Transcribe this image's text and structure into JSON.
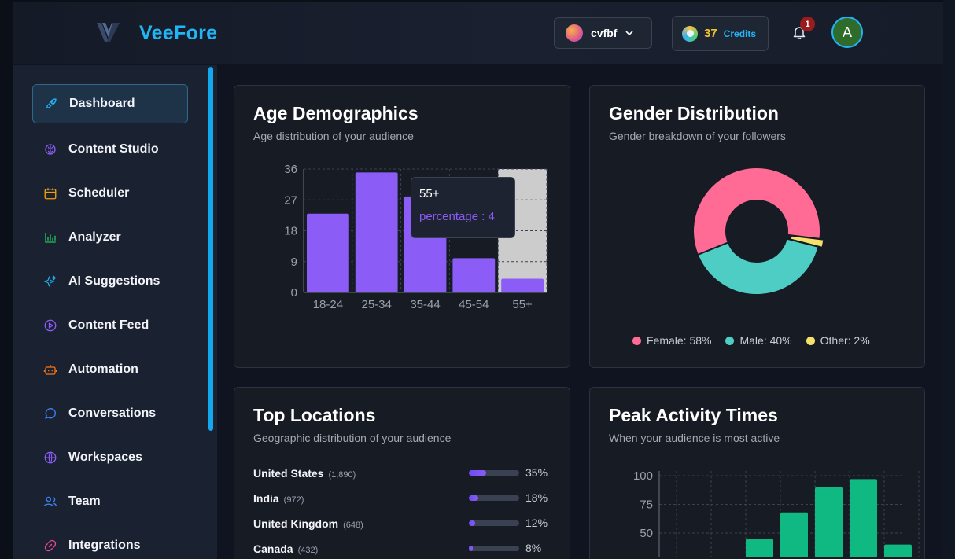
{
  "header": {
    "brand": "VeeFore",
    "workspace": {
      "name": "cvfbf"
    },
    "credits": {
      "count": "37",
      "label": "Credits"
    },
    "notifications": {
      "count": "1"
    },
    "user": {
      "initial": "A"
    }
  },
  "sidebar": {
    "items": [
      {
        "label": "Dashboard",
        "icon": "rocket-icon",
        "color": "#22b5f5"
      },
      {
        "label": "Content Studio",
        "icon": "brain-icon",
        "color": "#8b5cf6"
      },
      {
        "label": "Scheduler",
        "icon": "calendar-icon",
        "color": "#f59e0b"
      },
      {
        "label": "Analyzer",
        "icon": "bar-chart-icon",
        "color": "#22c55e"
      },
      {
        "label": "AI Suggestions",
        "icon": "sparkles-icon",
        "color": "#22b5f5"
      },
      {
        "label": "Content Feed",
        "icon": "play-circle-icon",
        "color": "#8b5cf6"
      },
      {
        "label": "Automation",
        "icon": "bot-icon",
        "color": "#f97316"
      },
      {
        "label": "Conversations",
        "icon": "message-icon",
        "color": "#3b82f6"
      },
      {
        "label": "Workspaces",
        "icon": "globe-icon",
        "color": "#8b5cf6"
      },
      {
        "label": "Team",
        "icon": "users-icon",
        "color": "#3b82f6"
      },
      {
        "label": "Integrations",
        "icon": "link-icon",
        "color": "#ec4899"
      }
    ]
  },
  "age_card": {
    "title": "Age Demographics",
    "subtitle": "Age distribution of your audience"
  },
  "gender_card": {
    "title": "Gender Distribution",
    "subtitle": "Gender breakdown of your followers"
  },
  "locations_card": {
    "title": "Top Locations",
    "subtitle": "Geographic distribution of your audience",
    "rows": [
      {
        "country": "United States",
        "count": "(1,890)",
        "pct": "35%",
        "share": 0.35
      },
      {
        "country": "India",
        "count": "(972)",
        "pct": "18%",
        "share": 0.18
      },
      {
        "country": "United Kingdom",
        "count": "(648)",
        "pct": "12%",
        "share": 0.12
      },
      {
        "country": "Canada",
        "count": "(432)",
        "pct": "8%",
        "share": 0.08
      }
    ]
  },
  "activity_card": {
    "title": "Peak Activity Times",
    "subtitle": "When your audience is most active"
  },
  "chart_data": [
    {
      "type": "bar",
      "categories": [
        "18-24",
        "25-34",
        "35-44",
        "45-54",
        "55+"
      ],
      "values": [
        23,
        35,
        28,
        10,
        4
      ],
      "ylim": [
        0,
        36
      ],
      "yticks": [
        0,
        9,
        18,
        27,
        36
      ],
      "color": "#8b5cf6",
      "highlighted": "55+",
      "tooltip": {
        "title": "55+",
        "label": "percentage : 4"
      },
      "grid": true
    },
    {
      "type": "pie",
      "donut": true,
      "slices": [
        {
          "name": "Female",
          "value": 58,
          "color": "#ff6b95",
          "legend": "Female: 58%"
        },
        {
          "name": "Male",
          "value": 40,
          "color": "#4ecdc4",
          "legend": "Male: 40%"
        },
        {
          "name": "Other",
          "value": 2,
          "color": "#f5e26b",
          "legend": "Other: 2%"
        }
      ]
    },
    {
      "type": "bar",
      "values": [
        45,
        68,
        90,
        97,
        40
      ],
      "ylim_visible": [
        40,
        100
      ],
      "yticks": [
        50,
        75,
        100
      ],
      "color": "#10b981",
      "grid": true
    }
  ]
}
